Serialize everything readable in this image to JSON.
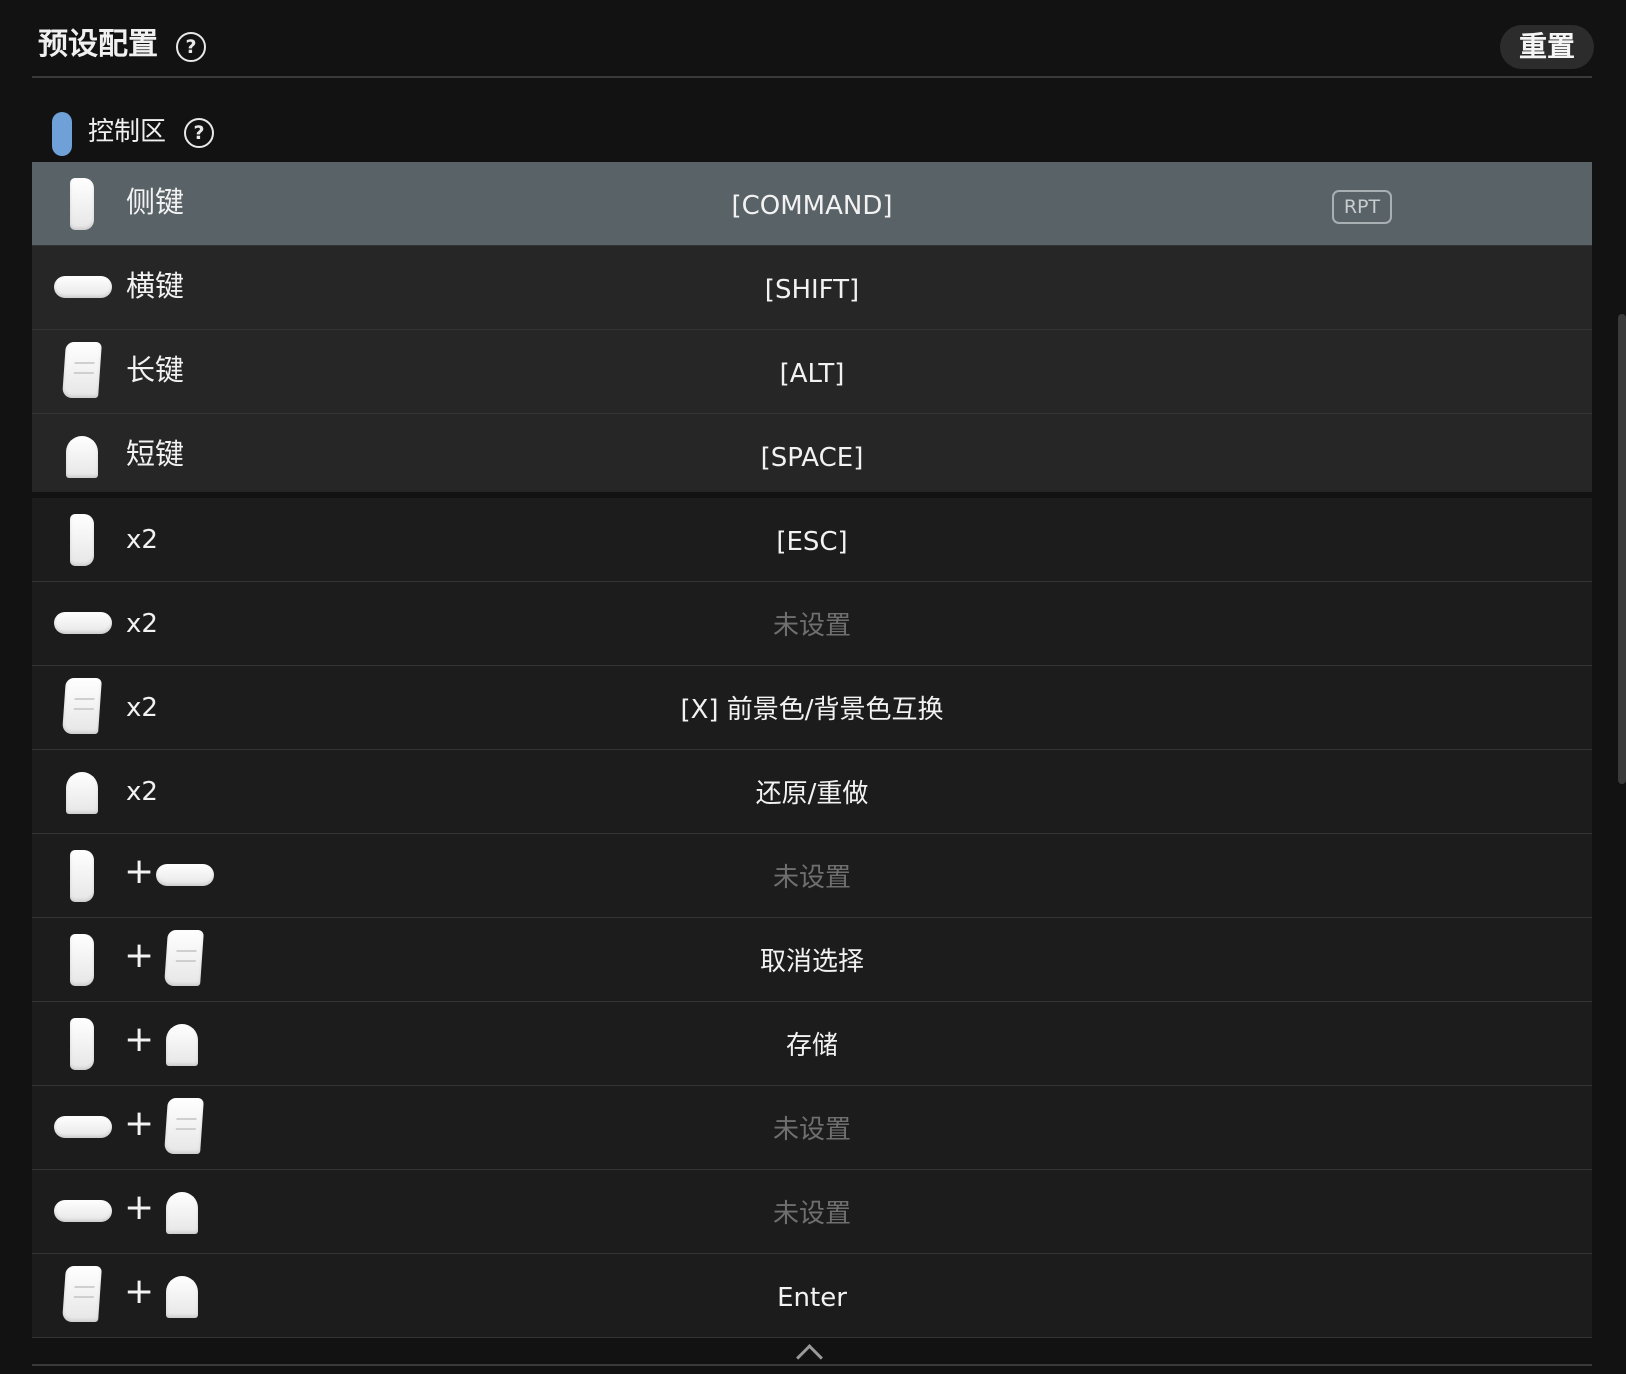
{
  "header": {
    "title": "预设配置",
    "help": "?",
    "reset_label": "重置"
  },
  "section": {
    "label": "控制区",
    "help": "?",
    "accent_color": "#6fa1d8"
  },
  "rows": [
    {
      "keys": [
        "side-key-icon"
      ],
      "label": "侧键",
      "value": "[COMMAND]",
      "badge": "RPT",
      "selected": true
    },
    {
      "keys": [
        "horizontal-key-icon"
      ],
      "label": "横键",
      "value": "[SHIFT]"
    },
    {
      "keys": [
        "long-key-icon"
      ],
      "label": "长键",
      "value": "[ALT]"
    },
    {
      "keys": [
        "short-key-icon"
      ],
      "label": "短键",
      "value": "[SPACE]"
    },
    {
      "keys": [
        "side-key-icon"
      ],
      "label": "x2",
      "value": "[ESC]"
    },
    {
      "keys": [
        "horizontal-key-icon"
      ],
      "label": "x2",
      "value": "未设置",
      "unset": true
    },
    {
      "keys": [
        "long-key-icon"
      ],
      "label": "x2",
      "value": "[X] 前景色/背景色互换"
    },
    {
      "keys": [
        "short-key-icon"
      ],
      "label": "x2",
      "value": "还原/重做"
    },
    {
      "keys": [
        "side-key-icon",
        "horizontal-key-icon"
      ],
      "label": "+",
      "value": "未设置",
      "unset": true
    },
    {
      "keys": [
        "side-key-icon",
        "long-key-icon"
      ],
      "label": "+",
      "value": "取消选择"
    },
    {
      "keys": [
        "side-key-icon",
        "short-key-icon"
      ],
      "label": "+",
      "value": "存储"
    },
    {
      "keys": [
        "horizontal-key-icon",
        "long-key-icon"
      ],
      "label": "+",
      "value": "未设置",
      "unset": true
    },
    {
      "keys": [
        "horizontal-key-icon",
        "short-key-icon"
      ],
      "label": "+",
      "value": "未设置",
      "unset": true
    },
    {
      "keys": [
        "long-key-icon",
        "short-key-icon"
      ],
      "label": "+",
      "value": "Enter"
    }
  ]
}
